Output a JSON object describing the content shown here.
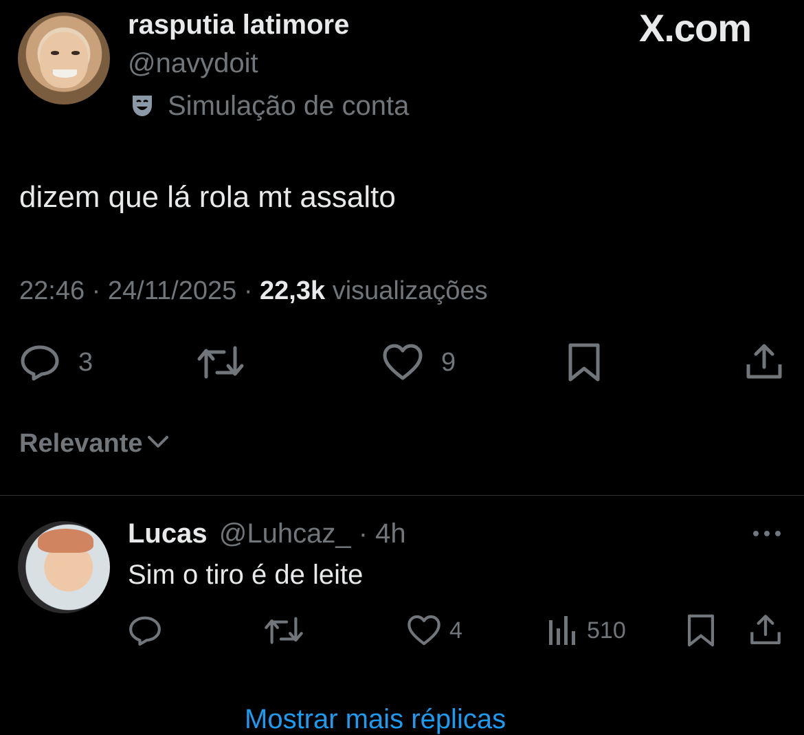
{
  "watermark": "X.com",
  "tweet": {
    "display_name": "rasputia latimore",
    "handle": "@navydoit",
    "account_label_icon": "theater-mask-icon",
    "account_label": "Simulação de conta",
    "text": "dizem que lá rola mt assalto",
    "time": "22:46",
    "separator": "·",
    "date": "24/11/2025",
    "views_count": "22,3k",
    "views_label": "visualizações",
    "actions": {
      "replies": "3",
      "retweets": "",
      "likes": "9"
    }
  },
  "sort": {
    "label": "Relevante"
  },
  "reply": {
    "display_name": "Lucas",
    "handle": "@Luhcaz_",
    "separator": "·",
    "age": "4h",
    "text": "Sim o tiro é de leite",
    "actions": {
      "likes": "4",
      "views": "510"
    }
  },
  "show_more": "Mostrar mais réplicas",
  "colors": {
    "background": "#000000",
    "text": "#e7e9ea",
    "muted": "#71767b",
    "accent": "#1d9bf0"
  }
}
